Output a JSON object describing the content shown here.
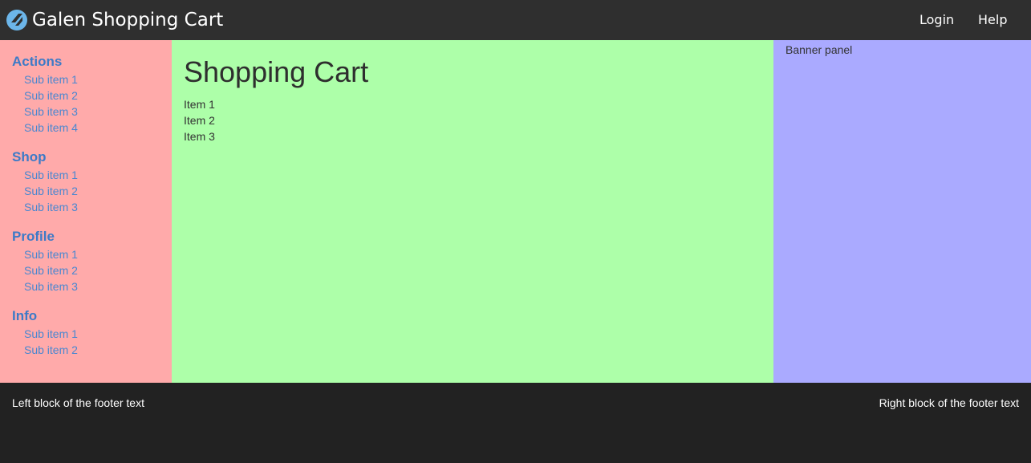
{
  "header": {
    "logo_icon": "galen-logo-icon",
    "brand": "Galen Shopping Cart",
    "nav": {
      "login": "Login",
      "help": "Help"
    },
    "background": "#2f2f2f"
  },
  "sidebar": {
    "background": "#ffaaaa",
    "sections": [
      {
        "title": "Actions",
        "items": [
          "Sub item 1",
          "Sub item 2",
          "Sub item 3",
          "Sub item 4"
        ]
      },
      {
        "title": "Shop",
        "items": [
          "Sub item 1",
          "Sub item 2",
          "Sub item 3"
        ]
      },
      {
        "title": "Profile",
        "items": [
          "Sub item 1",
          "Sub item 2",
          "Sub item 3"
        ]
      },
      {
        "title": "Info",
        "items": [
          "Sub item 1",
          "Sub item 2"
        ]
      }
    ]
  },
  "main": {
    "background": "#adffa9",
    "title": "Shopping Cart",
    "items": [
      "Item 1",
      "Item 2",
      "Item 3"
    ]
  },
  "banner": {
    "background": "#aaaaff",
    "text": "Banner panel"
  },
  "footer": {
    "background": "#222222",
    "left": "Left block of the footer text",
    "right": "Right block of the footer text"
  }
}
